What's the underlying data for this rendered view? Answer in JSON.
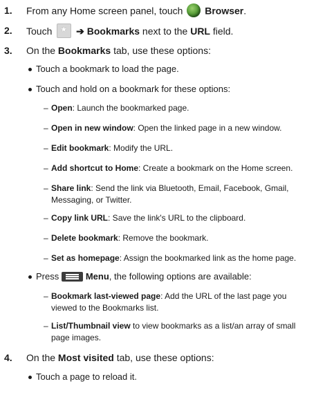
{
  "steps": [
    {
      "num": "1.",
      "pre": "From any Home screen panel, touch ",
      "bold": "Browser",
      "post": "."
    },
    {
      "num": "2.",
      "pre": "Touch ",
      "arrow": "➔",
      "b1": "Bookmarks",
      "mid": " next to the ",
      "b2": "URL",
      "post": " field."
    },
    {
      "num": "3.",
      "pre": "On the ",
      "bold": "Bookmarks",
      "post": " tab, use these options:"
    },
    {
      "num": "4.",
      "pre": "On the ",
      "bold": "Most visited",
      "post": " tab, use these options:"
    }
  ],
  "bullets": {
    "b1": "Touch a bookmark to load the page.",
    "b2": "Touch and hold on a bookmark for these options:",
    "b3_pre": "Press ",
    "b3_bold": "Menu",
    "b3_post": ", the following options are available:",
    "b4": "Touch a page to reload it."
  },
  "options": [
    {
      "term": "Open",
      "desc": ": Launch the bookmarked page."
    },
    {
      "term": "Open in new window",
      "desc": ": Open the linked page in a new window."
    },
    {
      "term": "Edit bookmark",
      "desc": ": Modify the URL."
    },
    {
      "term": "Add shortcut to Home",
      "desc": ": Create a bookmark on the Home screen."
    },
    {
      "term": "Share link",
      "desc": ": Send the link via Bluetooth, Email, Facebook, Gmail,",
      "cont": "Messaging, or Twitter."
    },
    {
      "term": "Copy link URL",
      "desc": ": Save the link's URL to the clipboard."
    },
    {
      "term": "Delete bookmark",
      "desc": ": Remove the bookmark."
    },
    {
      "term": "Set as homepage",
      "desc": ": Assign the bookmarked link as the home page."
    }
  ],
  "menu_options": [
    {
      "term": "Bookmark last-viewed page",
      "desc": ": Add the URL of the last page you",
      "cont": "viewed to the Bookmarks list."
    },
    {
      "term": "List/Thumbnail view",
      "desc": " to view bookmarks as a list/an array of small",
      "cont": "page images."
    }
  ],
  "icons": {
    "browser": "globe-icon",
    "bookmark": "bookmark-star-icon",
    "menu": "menu-icon"
  }
}
